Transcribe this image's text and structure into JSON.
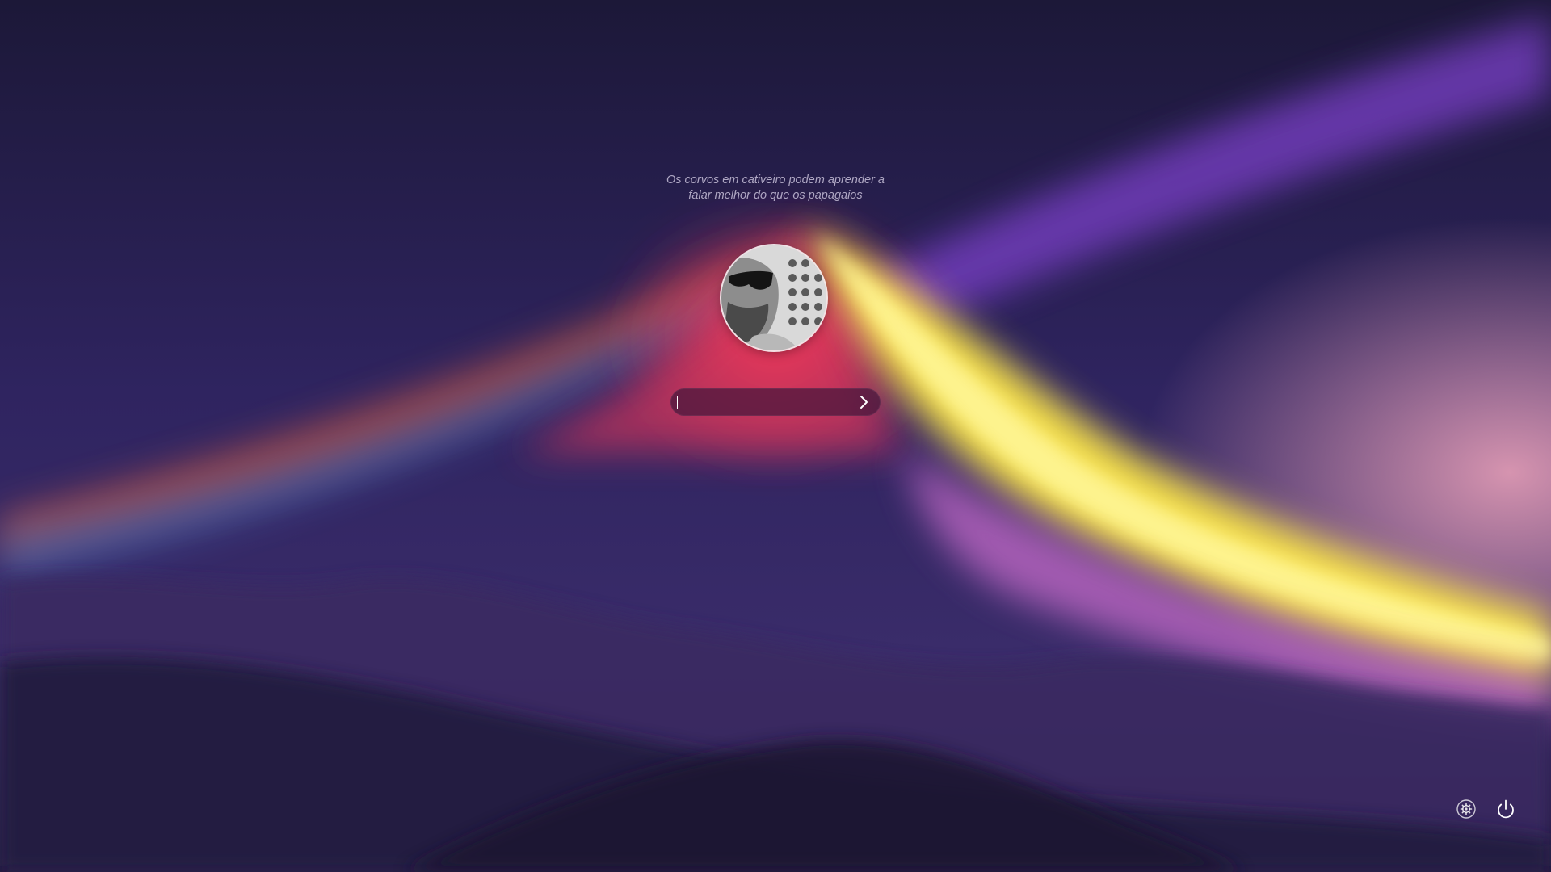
{
  "lock_screen": {
    "quote_line1": "Os corvos em cativeiro podem aprender a",
    "quote_line2": "falar melhor do que os papagaios",
    "password": {
      "value": "",
      "placeholder": ""
    },
    "submit_icon": "chevron-right-icon",
    "tray": {
      "settings_icon": "gear-icon",
      "power_icon": "power-icon"
    }
  },
  "colors": {
    "background_deep": "#2a1f4a",
    "aurora_red": "#e83a5c",
    "aurora_yellow": "#fff04a",
    "aurora_violet": "#7a3fc8",
    "field_background": "#461638",
    "text_muted": "#cdc6de",
    "icon": "#ffffff"
  }
}
